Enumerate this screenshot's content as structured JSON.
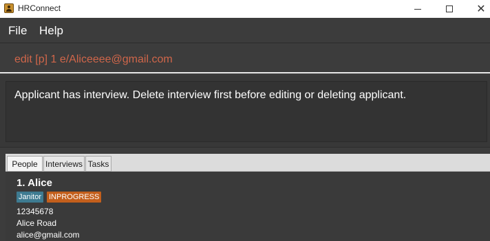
{
  "window": {
    "title": "HRConnect",
    "close_glyph": "✕"
  },
  "menu": {
    "items": [
      "File",
      "Help"
    ]
  },
  "command": {
    "value": "edit [p] 1 e/Aliceeee@gmail.com"
  },
  "result": {
    "message": "Applicant has interview. Delete interview first before editing or deleting applicant."
  },
  "tabs": [
    "People",
    "Interviews",
    "Tasks"
  ],
  "people": [
    {
      "index": "1.",
      "name": "Alice",
      "index_name": "1.  Alice",
      "tags": [
        "Janitor",
        "INPROGRESS"
      ],
      "phone": "12345678",
      "address": "Alice Road",
      "email": "alice@gmail.com"
    }
  ],
  "colors": {
    "command_text": "#d0664a",
    "role_tag": "#3e7b91",
    "status_tag": "#c35f1c",
    "background": "#3c3c3c"
  }
}
